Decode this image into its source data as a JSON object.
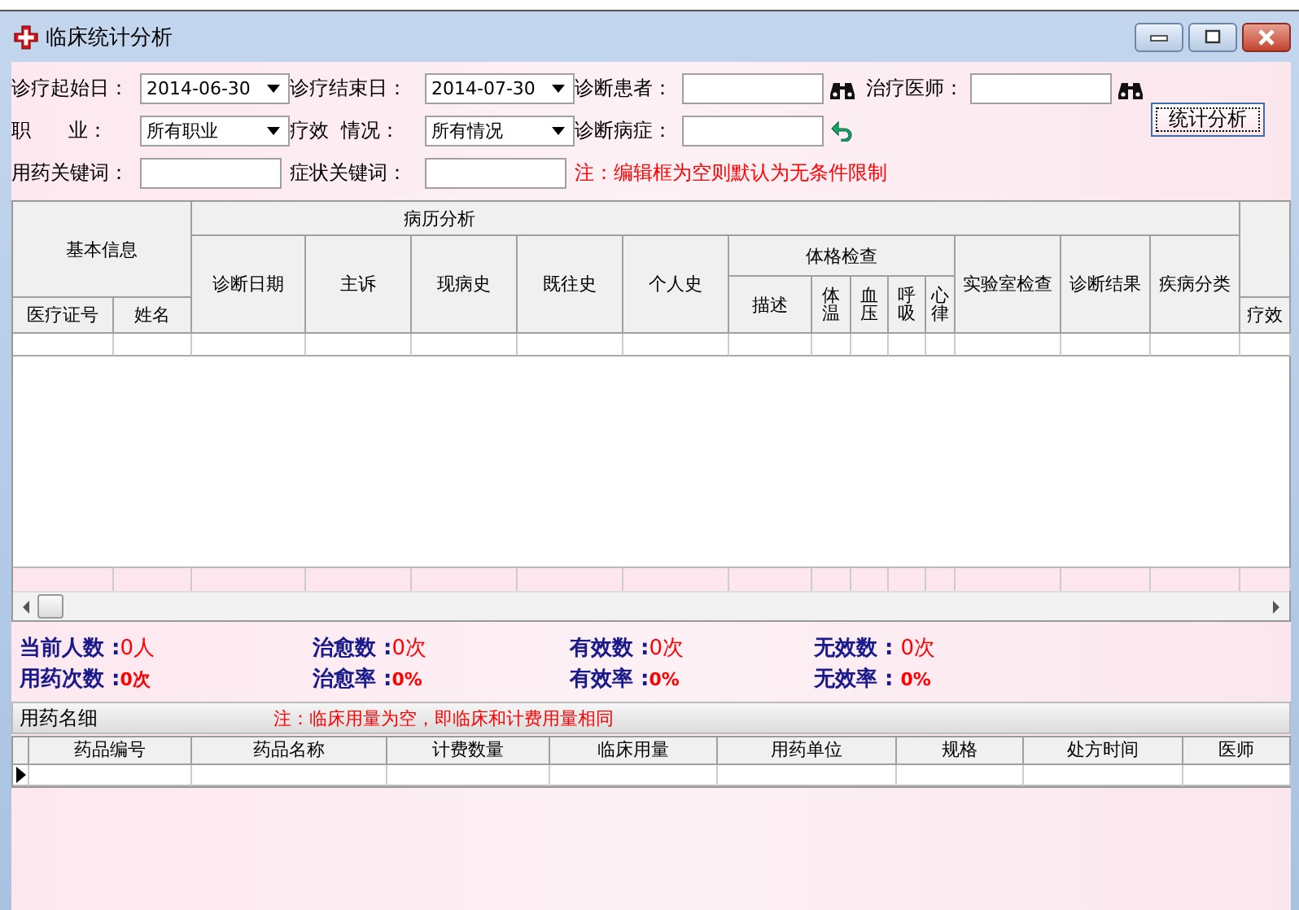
{
  "window": {
    "title": "临床统计分析"
  },
  "filters": [
    [
      {
        "kind": "label",
        "text": "诊疗起始日："
      },
      {
        "kind": "select",
        "value": "2014-06-30"
      },
      {
        "kind": "label",
        "text": "诊疗结束日："
      },
      {
        "kind": "select",
        "value": "2014-07-30"
      },
      {
        "kind": "label",
        "text": "诊断患者："
      },
      {
        "kind": "lookup"
      },
      {
        "kind": "label",
        "text": "治疗医师："
      },
      {
        "kind": "lookup"
      }
    ],
    [
      {
        "kind": "label",
        "text": "职      业："
      },
      {
        "kind": "select",
        "value": "所有职业"
      },
      {
        "kind": "label",
        "text": "疗效  情况："
      },
      {
        "kind": "select",
        "value": "所有情况"
      },
      {
        "kind": "label",
        "text": "诊断病症："
      },
      {
        "kind": "reset"
      }
    ],
    [
      {
        "kind": "label",
        "text": "用药关键词："
      },
      {
        "kind": "text"
      },
      {
        "kind": "label",
        "text": "症状关键词："
      },
      {
        "kind": "text"
      },
      {
        "kind": "note",
        "text": "注：编辑框为空则默认为无条件限制"
      }
    ]
  ],
  "analyze_button": "统计分析",
  "table": {
    "basic_group": "基本信息",
    "basic_columns": [
      "医疗证号",
      "姓名"
    ],
    "analysis_group": "病历分析",
    "analysis_columns": [
      "诊断日期",
      "主诉",
      "现病史",
      "既往史",
      "个人史"
    ],
    "exam_group": "体格检查",
    "exam_columns": [
      "描述",
      "体温",
      "血压",
      "呼吸",
      "心律"
    ],
    "result_columns": [
      "实验室检查",
      "诊断结果",
      "疾病分类"
    ],
    "last_column": "疗效"
  },
  "stats": [
    {
      "label": "当前人数 :",
      "value": "0人"
    },
    {
      "label": "治愈数 :",
      "value": "0次"
    },
    {
      "label": "有效数 :",
      "value": "0次"
    },
    {
      "label": "无效数 : ",
      "value": "0次"
    },
    {
      "label": "用药次数 :",
      "value": "0次"
    },
    {
      "label": "治愈率 :",
      "value": "0%"
    },
    {
      "label": "有效率 :",
      "value": "0%"
    },
    {
      "label": "无效率 : ",
      "value": "0%"
    }
  ],
  "drug_section": {
    "title": "用药名细",
    "note": "注：临床用量为空，即临床和计费用量相同",
    "columns": [
      "药品编号",
      "药品名称",
      "计费数量",
      "临床用量",
      "用药单位",
      "规格",
      "处方时间",
      "医师"
    ]
  }
}
